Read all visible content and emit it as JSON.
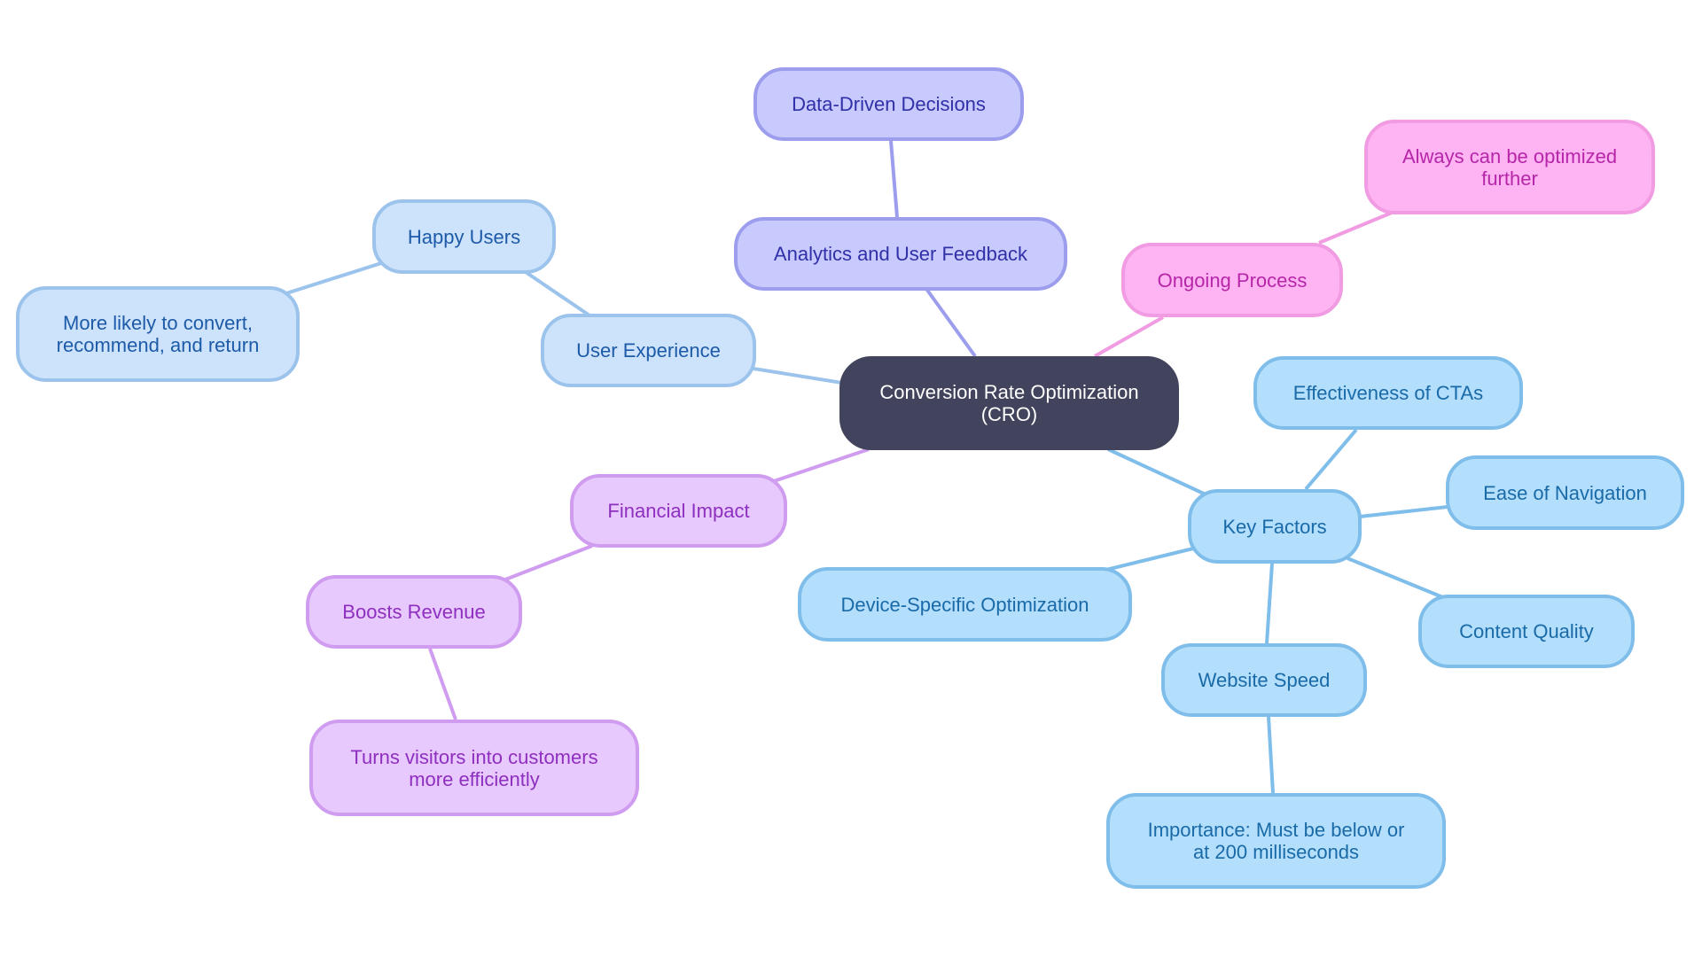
{
  "diagram": {
    "type": "mindmap",
    "root": {
      "id": "root",
      "label": "Conversion Rate Optimization\n(CRO)"
    },
    "branches": [
      {
        "id": "ux",
        "label": "User Experience",
        "children": [
          {
            "id": "happy",
            "label": "Happy Users",
            "children": [
              {
                "id": "likely",
                "label": "More likely to convert,\nrecommend, and return"
              }
            ]
          }
        ]
      },
      {
        "id": "analytics",
        "label": "Analytics and User Feedback",
        "children": [
          {
            "id": "datadriven",
            "label": "Data-Driven Decisions"
          }
        ]
      },
      {
        "id": "ongoing",
        "label": "Ongoing Process",
        "children": [
          {
            "id": "always",
            "label": "Always can be optimized\nfurther"
          }
        ]
      },
      {
        "id": "financial",
        "label": "Financial Impact",
        "children": [
          {
            "id": "boosts",
            "label": "Boosts Revenue",
            "children": [
              {
                "id": "turns",
                "label": "Turns visitors into customers\nmore efficiently"
              }
            ]
          }
        ]
      },
      {
        "id": "key",
        "label": "Key Factors",
        "children": [
          {
            "id": "cta",
            "label": "Effectiveness of CTAs"
          },
          {
            "id": "nav",
            "label": "Ease of Navigation"
          },
          {
            "id": "device",
            "label": "Device-Specific Optimization"
          },
          {
            "id": "content",
            "label": "Content Quality"
          },
          {
            "id": "speed",
            "label": "Website Speed",
            "children": [
              {
                "id": "importance",
                "label": "Importance: Must be below or\nat 200 milliseconds"
              }
            ]
          }
        ]
      }
    ],
    "colors": {
      "root_fill": "#41445c",
      "ux": "#9cc3eb",
      "analytics": "#9c9ded",
      "ongoing": "#f09be2",
      "financial": "#cf9cf0",
      "key": "#7fbdea"
    }
  }
}
